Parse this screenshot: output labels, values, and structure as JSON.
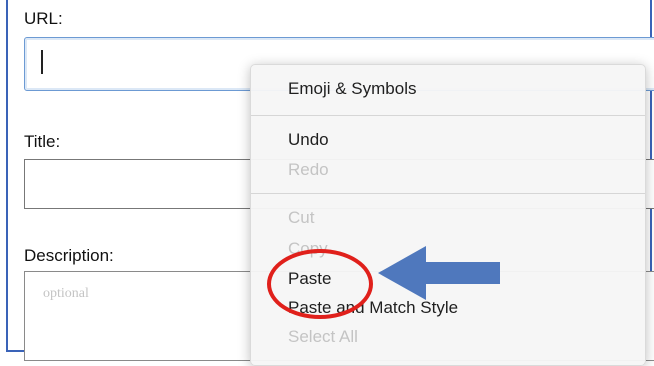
{
  "form": {
    "url_label": "URL:",
    "title_label": "Title:",
    "description_label": "Description:",
    "description_placeholder": "optional"
  },
  "context_menu": {
    "items": [
      {
        "label": "Emoji & Symbols",
        "enabled": true
      },
      {
        "label": "Undo",
        "enabled": true
      },
      {
        "label": "Redo",
        "enabled": false
      },
      {
        "label": "Cut",
        "enabled": false
      },
      {
        "label": "Copy",
        "enabled": false
      },
      {
        "label": "Paste",
        "enabled": true
      },
      {
        "label": "Paste and Match Style",
        "enabled": true
      },
      {
        "label": "Select All",
        "enabled": false
      }
    ]
  },
  "annotation": {
    "highlight_color": "#e0201b",
    "arrow_color": "#4f78bd",
    "arrow_icon": "left-arrow-icon",
    "highlight_icon": "red-circle-highlight"
  }
}
